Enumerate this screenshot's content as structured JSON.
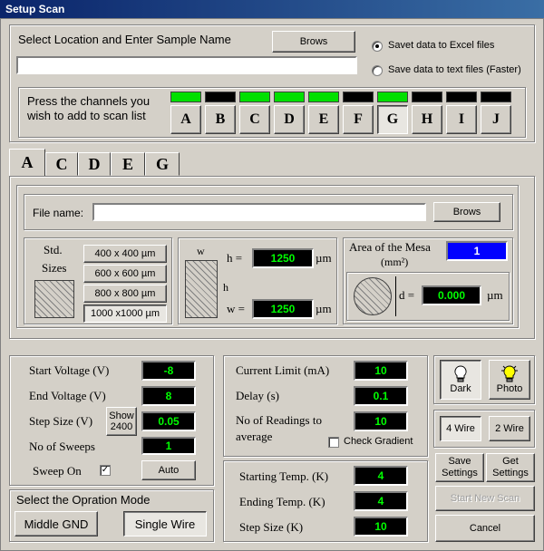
{
  "window": {
    "title": "Setup Scan"
  },
  "location": {
    "label": "Select Location and Enter Sample Name",
    "browse": "Brows",
    "path_value": "",
    "options": [
      "Savet data to Excel files",
      "Save data to text files (Faster)"
    ],
    "selected": 0
  },
  "channels": {
    "prompt_line1": "Press the channels you",
    "prompt_line2": "wish to add to scan list",
    "items": [
      {
        "label": "A",
        "active": true,
        "pressed": false
      },
      {
        "label": "B",
        "active": false,
        "pressed": false
      },
      {
        "label": "C",
        "active": true,
        "pressed": false
      },
      {
        "label": "D",
        "active": true,
        "pressed": false
      },
      {
        "label": "E",
        "active": true,
        "pressed": false
      },
      {
        "label": "F",
        "active": false,
        "pressed": false
      },
      {
        "label": "G",
        "active": true,
        "pressed": true
      },
      {
        "label": "H",
        "active": false,
        "pressed": false
      },
      {
        "label": "I",
        "active": false,
        "pressed": false
      },
      {
        "label": "J",
        "active": false,
        "pressed": false
      }
    ],
    "on_color": "#00e000",
    "off_color": "#000000"
  },
  "tabs": [
    "A",
    "C",
    "D",
    "E",
    "G"
  ],
  "file": {
    "label": "File name:",
    "value": "",
    "browse": "Brows"
  },
  "sizes": {
    "title_line1": "Std.",
    "title_line2": "Sizes",
    "options": [
      "400 x 400 µm",
      "600 x 600 µm",
      "800 x 800 µm",
      "1000 x1000 µm"
    ],
    "selected": 3
  },
  "rect": {
    "w_label": "w",
    "h_label": "h",
    "h_eq": "h =",
    "w_eq": "w =",
    "h_value": "1250",
    "w_value": "1250",
    "unit": "µm"
  },
  "mesa": {
    "title": "Area of the Mesa",
    "unit": "(mm²)",
    "area": "1",
    "d_eq": "d =",
    "d_value": "0.000",
    "d_unit": "µm"
  },
  "voltage": {
    "start_label": "Start Voltage (V)",
    "start": "-8",
    "end_label": "End Voltage (V)",
    "end": "8",
    "step_label": "Step Size (V)",
    "step": "0.05",
    "show_line1": "Show",
    "show_line2": "2400",
    "sweeps_label": "No of Sweeps",
    "sweeps": "1",
    "sweep_on_label": "Sweep On",
    "sweep_on_mark": "✓",
    "auto": "Auto"
  },
  "mode": {
    "title": "Select the Opration Mode",
    "middle": "Middle GND",
    "single": "Single Wire"
  },
  "current": {
    "limit_label": "Current Limit (mA)",
    "limit": "10",
    "delay_label": "Delay (s)",
    "delay": "0.1",
    "readings_line1": "No of Readings to",
    "readings_line2": "average",
    "readings": "10",
    "gradient_label": "Check Gradient"
  },
  "temp": {
    "start_label": "Starting Temp. (K)",
    "start": "4",
    "end_label": "Ending Temp. (K)",
    "end": "4",
    "step_label": "Step Size (K)",
    "step": "10"
  },
  "actions": {
    "dark": "Dark",
    "photo": "Photo",
    "wire4": "4 Wire",
    "wire2": "2 Wire",
    "save_line1": "Save",
    "save_line2": "Settings",
    "get_line1": "Get",
    "get_line2": "Settings",
    "start": "Start New Scan",
    "cancel": "Cancel"
  }
}
